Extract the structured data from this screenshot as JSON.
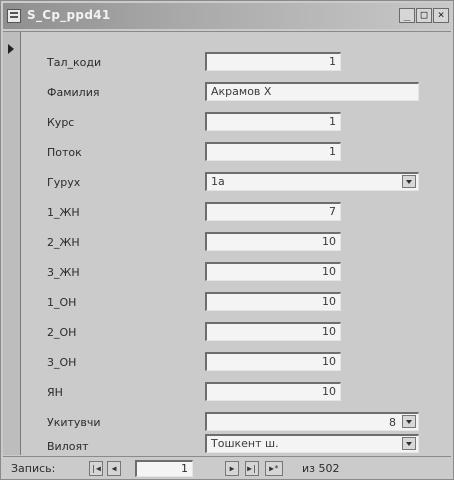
{
  "window": {
    "title": "S_Cp_ppd41",
    "controls": {
      "minimize": "_",
      "maximize": "□",
      "close": "×"
    }
  },
  "form": {
    "fields": [
      {
        "label": "Тал_коди",
        "value": "1",
        "align": "right"
      },
      {
        "label": "Фамилия",
        "value": "Акрамов Х",
        "align": "left"
      },
      {
        "label": "Курс",
        "value": "1",
        "align": "right"
      },
      {
        "label": "Поток",
        "value": "1",
        "align": "right"
      },
      {
        "label": "Гурух",
        "value": "1а",
        "align": "left"
      },
      {
        "label": "1_ЖН",
        "value": "7",
        "align": "right"
      },
      {
        "label": "2_ЖН",
        "value": "10",
        "align": "right"
      },
      {
        "label": "3_ЖН",
        "value": "10",
        "align": "right"
      },
      {
        "label": "1_ОН",
        "value": "10",
        "align": "right"
      },
      {
        "label": "2_ОН",
        "value": "10",
        "align": "right"
      },
      {
        "label": "3_ОН",
        "value": "10",
        "align": "right"
      },
      {
        "label": "ЯН",
        "value": "10",
        "align": "right"
      },
      {
        "label": "Укитувчи",
        "value": "8",
        "align": "right"
      },
      {
        "label": "Вилоят",
        "value": "Тошкент ш.",
        "align": "left"
      }
    ]
  },
  "navigation": {
    "record_label": "Запись:",
    "first": "|◀",
    "prev": "◀",
    "current_record": "1",
    "next": "▶",
    "last": "▶|",
    "new": "▶*",
    "of_text": "из 502"
  }
}
